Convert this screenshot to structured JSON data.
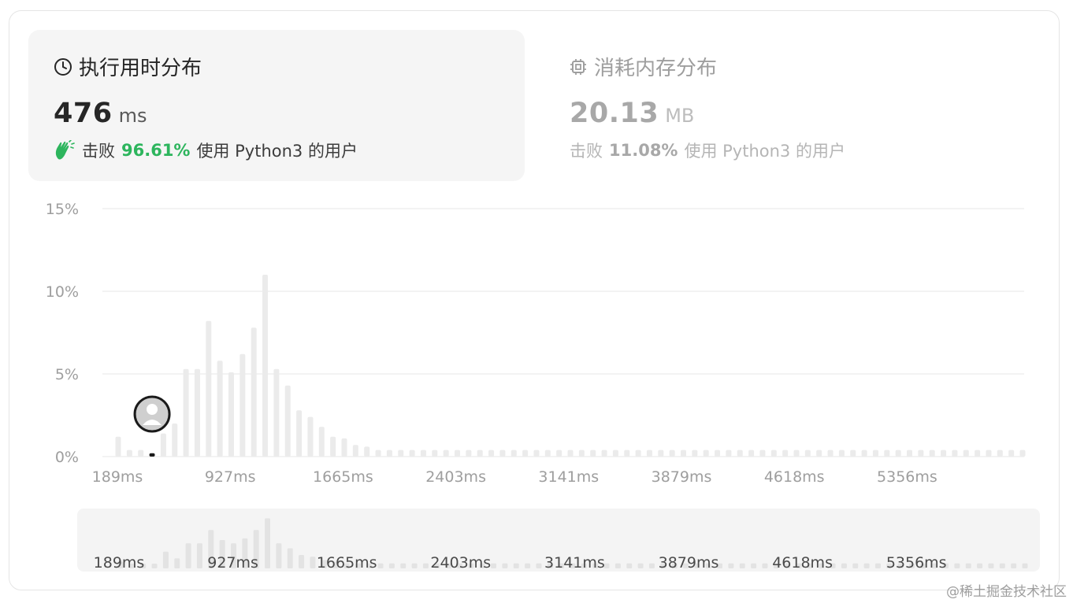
{
  "runtime_panel": {
    "title": "执行用时分布",
    "value": "476",
    "unit": "ms",
    "beats_prefix": "击败",
    "beats_pct": "96.61%",
    "beats_suffix": "使用 Python3 的用户",
    "icon": "clock-icon",
    "accent_color": "#2db55d"
  },
  "memory_panel": {
    "title": "消耗内存分布",
    "value": "20.13",
    "unit": "MB",
    "beats_prefix": "击败",
    "beats_pct": "11.08%",
    "beats_suffix": "使用 Python3 的用户",
    "icon": "chip-icon"
  },
  "watermark": "@稀土掘金技术社区",
  "chart_data": {
    "type": "bar",
    "title": "",
    "xlabel": "",
    "ylabel": "",
    "ylim": [
      0,
      15
    ],
    "y_ticks": [
      "15%",
      "10%",
      "5%",
      "0%"
    ],
    "y_tick_values": [
      15,
      10,
      5,
      0
    ],
    "x_tick_labels": [
      "189ms",
      "927ms",
      "1665ms",
      "2403ms",
      "3141ms",
      "3879ms",
      "4618ms",
      "5356ms"
    ],
    "grid": true,
    "values": [
      1.2,
      0.4,
      0.4,
      0.2,
      1.4,
      2.0,
      5.3,
      5.3,
      8.2,
      5.8,
      5.1,
      6.2,
      7.8,
      11.0,
      5.3,
      4.3,
      2.8,
      2.4,
      1.8,
      1.2,
      1.1,
      0.7,
      0.6,
      0.4,
      0.4,
      0.4,
      0.4,
      0.4,
      0.4,
      0.4,
      0.4,
      0.4,
      0.4,
      0.4,
      0.4,
      0.4,
      0.4,
      0.4,
      0.4,
      0.4,
      0.4,
      0.4,
      0.4,
      0.4,
      0.4,
      0.4,
      0.4,
      0.4,
      0.4,
      0.4,
      0.4,
      0.4,
      0.4,
      0.4,
      0.4,
      0.4,
      0.4,
      0.4,
      0.4,
      0.4,
      0.4,
      0.4,
      0.4,
      0.4,
      0.4,
      0.4,
      0.4,
      0.4,
      0.4,
      0.4,
      0.4,
      0.4,
      0.4,
      0.4,
      0.4,
      0.4,
      0.4,
      0.4,
      0.4,
      0.4,
      0.4
    ],
    "highlight_index": 3,
    "bar_color": "#ebebeb",
    "highlight_color": "#1a1a1a",
    "overview_values": [
      0.4,
      0.2,
      0.2,
      0.2,
      1.0,
      0.6,
      1.5,
      1.5,
      2.3,
      1.7,
      1.5,
      1.8,
      2.3,
      3.0,
      1.5,
      1.2,
      0.8,
      0.7,
      0.5,
      0.4,
      0.3,
      0.3,
      0.3,
      0.3,
      0.3,
      0.3,
      0.3,
      0.3,
      0.3,
      0.3,
      0.3,
      0.3,
      0.3,
      0.3,
      0.3,
      0.3,
      0.3,
      0.3,
      0.3,
      0.3,
      0.3,
      0.3,
      0.3,
      0.3,
      0.3,
      0.3,
      0.3,
      0.3,
      0.3,
      0.3,
      0.3,
      0.3,
      0.3,
      0.3,
      0.3,
      0.3,
      0.3,
      0.3,
      0.3,
      0.3,
      0.3,
      0.3,
      0.3,
      0.3,
      0.3,
      0.3,
      0.3,
      0.3,
      0.3,
      0.3,
      0.3,
      0.3,
      0.3,
      0.3,
      0.3,
      0.3,
      0.3,
      0.3,
      0.3,
      0.3,
      0.3
    ]
  }
}
